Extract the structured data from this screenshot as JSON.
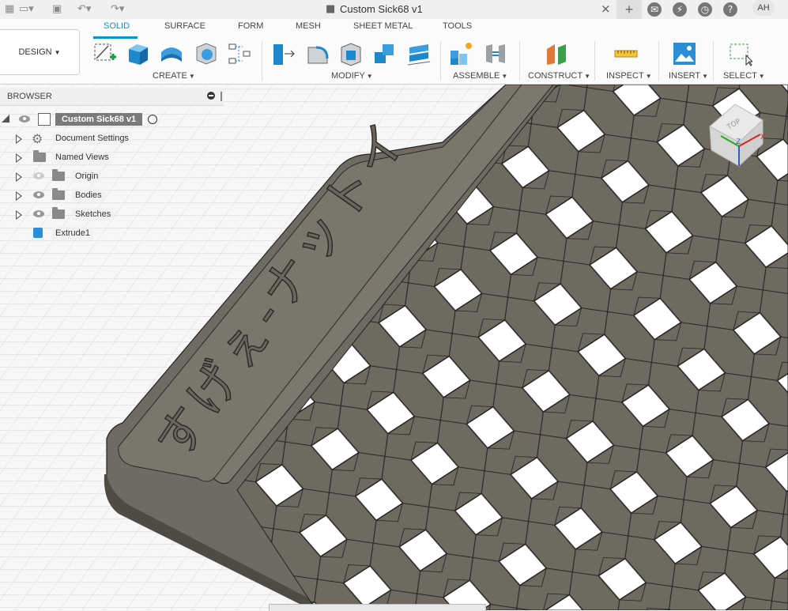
{
  "window": {
    "title": "Custom Sick68 v1",
    "user_initials": "AH"
  },
  "toolbar": {
    "workspace_label": "DESIGN",
    "tabs": [
      {
        "label": "SOLID",
        "active": true
      },
      {
        "label": "SURFACE"
      },
      {
        "label": "FORM"
      },
      {
        "label": "MESH"
      },
      {
        "label": "SHEET METAL"
      },
      {
        "label": "TOOLS"
      }
    ],
    "groups": [
      "CREATE",
      "MODIFY",
      "ASSEMBLE",
      "CONSTRUCT",
      "INSPECT",
      "INSERT",
      "SELECT"
    ],
    "accent_color": "#0696d7"
  },
  "browser": {
    "title": "BROWSER",
    "root": "Custom Sick68 v1",
    "items": [
      {
        "label": "Document Settings",
        "icon": "gear-icon"
      },
      {
        "label": "Named Views",
        "icon": "folder-icon"
      },
      {
        "label": "Origin",
        "icon": "folder-icon"
      },
      {
        "label": "Bodies",
        "icon": "folder-icon"
      },
      {
        "label": "Sketches",
        "icon": "folder-icon"
      },
      {
        "label": "Extrude1",
        "icon": "body-icon"
      }
    ]
  },
  "viewcube": {
    "face": "TOP",
    "axes": [
      "X",
      "Y",
      "Z"
    ]
  },
  "model": {
    "embossed_text": "すげぇ-ナットイ",
    "body_color": "#7a766b"
  }
}
